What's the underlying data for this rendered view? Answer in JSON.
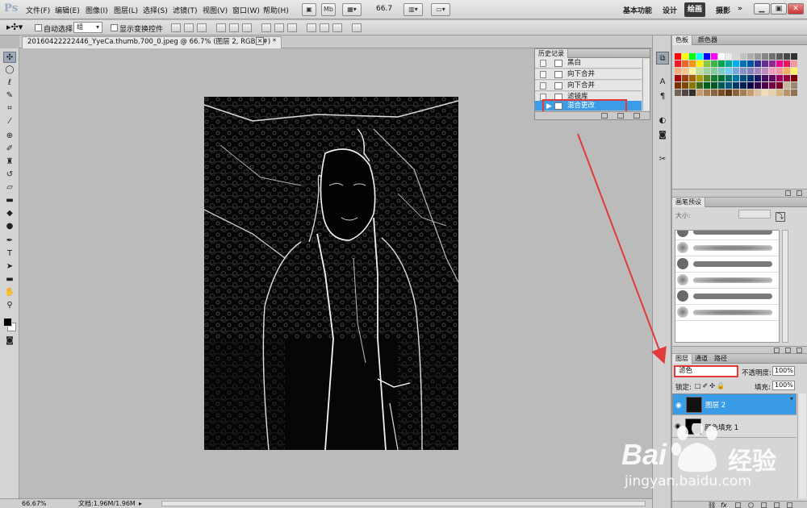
{
  "menubar": {
    "logo": "Ps",
    "menus": [
      "文件(F)",
      "编辑(E)",
      "图像(I)",
      "图层(L)",
      "选择(S)",
      "滤镜(T)",
      "视图(V)",
      "窗口(W)",
      "帮助(H)"
    ],
    "zoom": "66.7",
    "mb_label": "Mb",
    "workspaces": [
      "基本功能",
      "设计",
      "绘画",
      "摄影"
    ],
    "active_workspace": "绘画",
    "more": "»"
  },
  "options": {
    "auto_select_label": "自动选择:",
    "auto_select_value": "组",
    "show_transform_label": "显示变换控件"
  },
  "document": {
    "tab_title": "20160422222446_YyeCa.thumb.700_0.jpeg @ 66.7% (图层 2, RGB/8#) *",
    "close": "×"
  },
  "history": {
    "tabs": [
      "历史记录"
    ],
    "items": [
      "黑白",
      "向下合并",
      "向下合并",
      "滤镜库",
      "混合更改"
    ],
    "selected_index": 4
  },
  "swatches_panel": {
    "tabs": [
      "色板",
      "颜色器"
    ]
  },
  "brushes_panel": {
    "tabs": [
      "画笔预设"
    ],
    "size_label": "大小:"
  },
  "layers_panel": {
    "tabs": [
      "图层",
      "通道",
      "路径"
    ],
    "blend_mode": "滤色",
    "opacity_label": "不透明度:",
    "opacity_value": "100%",
    "lock_label": "锁定:",
    "fill_label": "填充:",
    "fill_value": "100%",
    "layers": [
      {
        "name": "图层 2",
        "selected": true
      },
      {
        "name": "颜色填充 1",
        "selected": false
      }
    ]
  },
  "status": {
    "zoom": "66.67%",
    "doc_info": "文档:1.96M/1.96M"
  },
  "watermark": {
    "brand": "Bai",
    "brand_suffix": "经验",
    "url": "jingyan.baidu.com"
  },
  "colors": {
    "selected_blue": "#3a9be6",
    "annotation_red": "#e03a3a"
  }
}
